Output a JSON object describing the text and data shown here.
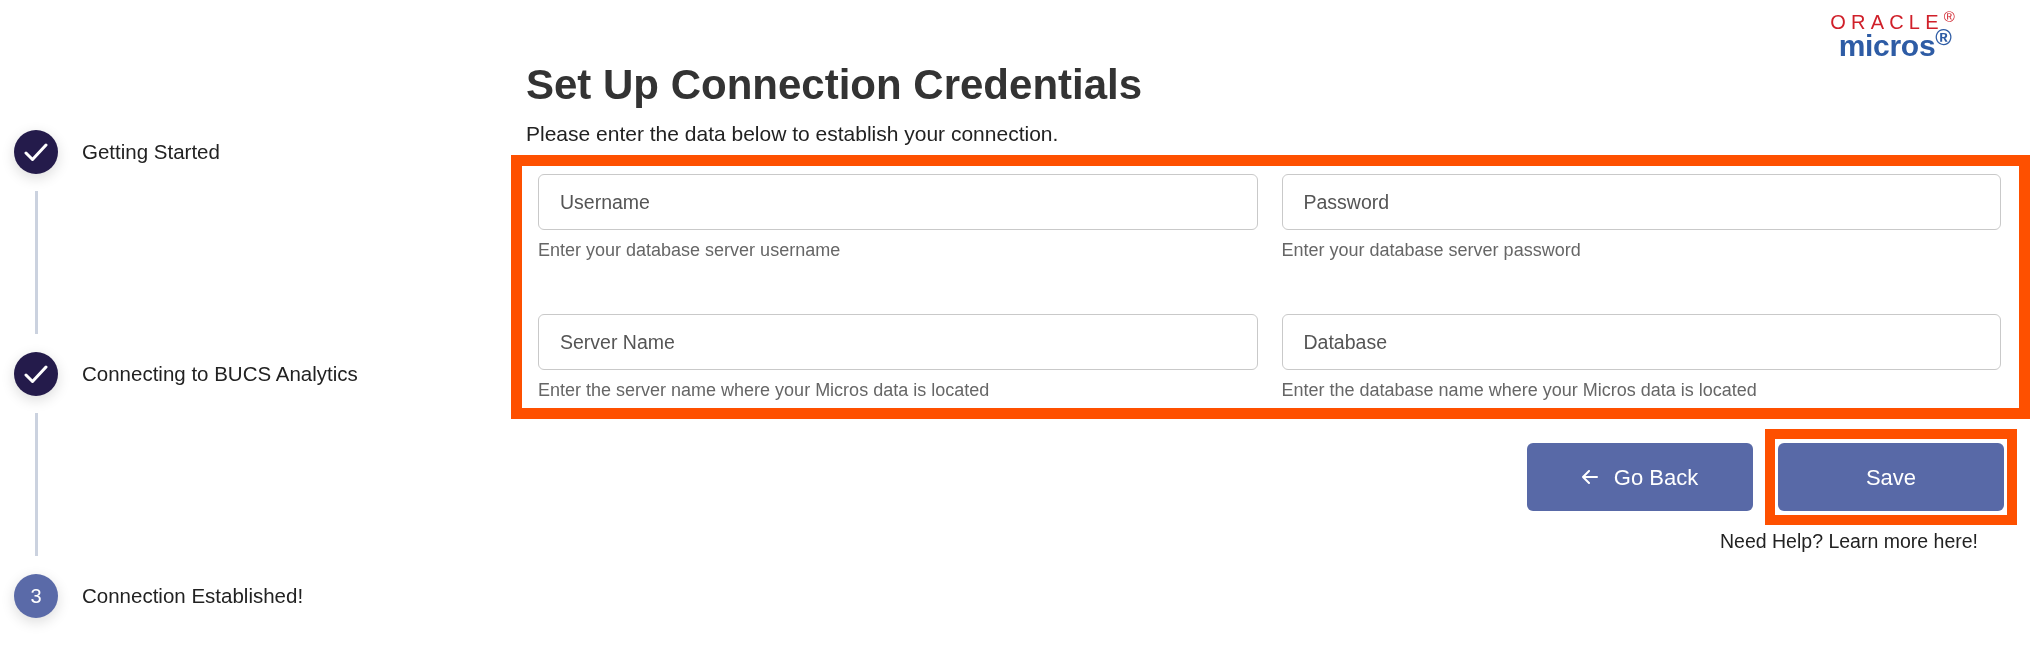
{
  "logo": {
    "top": "ORACLE$^{®}$",
    "bottom": "micros$^{®}$"
  },
  "steps": [
    {
      "label": "Getting Started",
      "completed": true
    },
    {
      "label": "Connecting to BUCS Analytics",
      "completed": true
    },
    {
      "label": "Connection Established!",
      "completed": false,
      "number": "3"
    }
  ],
  "title": "Set Up Connection Credentials",
  "subtitle": "Please enter the data below to establish your connection.",
  "form": {
    "highlighted": true,
    "fields": [
      {
        "placeholder": "Username",
        "hint": "Enter your database server username"
      },
      {
        "placeholder": "Password",
        "hint": "Enter your database server password"
      },
      {
        "placeholder": "Server Name",
        "hint": "Enter the server name where your Micros data is located"
      },
      {
        "placeholder": "Database",
        "hint": "Enter the database name where your Micros data is located"
      }
    ]
  },
  "buttons": [
    {
      "label": "Go Back",
      "kind": "back",
      "highlighted": false
    },
    {
      "label": "Save",
      "kind": "primary",
      "highlighted": true
    }
  ],
  "help_link": "Need Help? Learn more here!"
}
